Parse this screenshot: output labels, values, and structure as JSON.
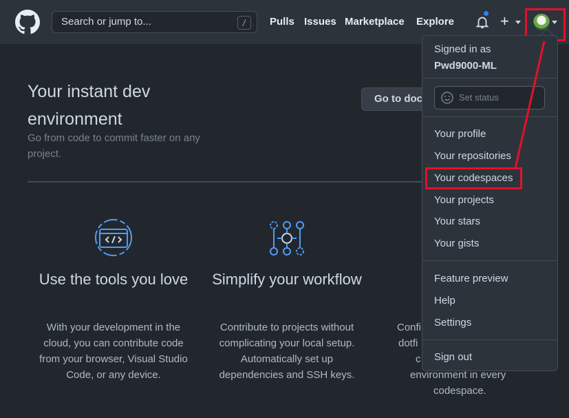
{
  "header": {
    "search_placeholder": "Search or jump to...",
    "search_shortcut": "/",
    "nav": [
      "Pulls",
      "Issues",
      "Marketplace",
      "Explore"
    ],
    "plus_label": "+",
    "notification_dot_color": "#2f81f7"
  },
  "hero": {
    "title": "Your instant dev environment",
    "subtitle": "Go from code to commit faster on any project.",
    "docs_button": "Go to docs"
  },
  "features": [
    {
      "icon": "code-window-icon",
      "title": "Use the tools you love",
      "desc": "With your development in the cloud, you can contribute code from your browser, Visual Studio Code, or any device."
    },
    {
      "icon": "workflow-icon",
      "title": "Simplify your workflow",
      "desc": "Contribute to projects without complicating your local setup. Automatically set up dependencies and SSH keys."
    },
    {
      "icon": "",
      "title": "",
      "desc": "Confi... dotfi... c... environment in every codespace."
    }
  ],
  "third_feature_visible": [
    "Confi",
    "dotfi",
    "c",
    "environment in every",
    "codespace."
  ],
  "menu": {
    "signed_in_label": "Signed in as",
    "username": "Pwd9000-ML",
    "status_placeholder": "Set status",
    "group1": [
      "Your profile",
      "Your repositories",
      "Your codespaces",
      "Your projects",
      "Your stars",
      "Your gists"
    ],
    "group2": [
      "Feature preview",
      "Help",
      "Settings"
    ],
    "sign_out": "Sign out",
    "highlighted": "Your codespaces"
  },
  "colors": {
    "background": "#22272e",
    "header": "#2d333b",
    "annotation": "#e5102a",
    "icon_blue": "#539bf5"
  }
}
